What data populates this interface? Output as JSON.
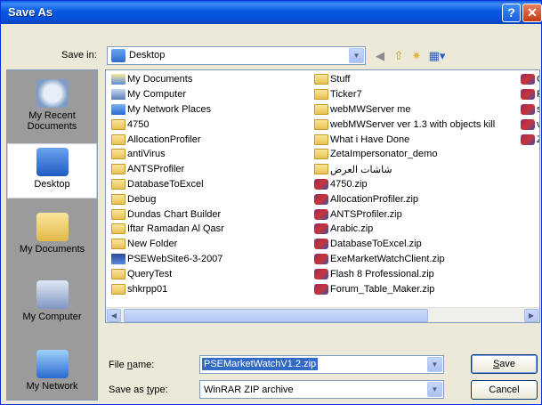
{
  "window": {
    "title": "Save As",
    "help_glyph": "?",
    "close_glyph": "✕"
  },
  "savein": {
    "label": "Save in:",
    "value": "Desktop"
  },
  "places": [
    {
      "label": "My Recent Documents",
      "icon": "recent-documents-icon"
    },
    {
      "label": "Desktop",
      "icon": "desktop-icon"
    },
    {
      "label": "My Documents",
      "icon": "my-documents-icon"
    },
    {
      "label": "My Computer",
      "icon": "my-computer-icon"
    },
    {
      "label": "My Network",
      "icon": "network-icon"
    }
  ],
  "files": {
    "col1": [
      {
        "name": "My Documents",
        "type": "docs"
      },
      {
        "name": "My Computer",
        "type": "pc"
      },
      {
        "name": "My Network Places",
        "type": "net"
      },
      {
        "name": "4750",
        "type": "folder"
      },
      {
        "name": "AllocationProfiler",
        "type": "folder"
      },
      {
        "name": "antiVirus",
        "type": "folder"
      },
      {
        "name": "ANTSProfiler",
        "type": "folder"
      },
      {
        "name": "DatabaseToExcel",
        "type": "folder"
      },
      {
        "name": "Debug",
        "type": "folder"
      },
      {
        "name": "Dundas Chart Builder",
        "type": "folder"
      },
      {
        "name": "Iftar Ramadan Al Qasr",
        "type": "folder"
      },
      {
        "name": "New Folder",
        "type": "folder"
      },
      {
        "name": "PSEWebSite6-3-2007",
        "type": "proj"
      },
      {
        "name": "QueryTest",
        "type": "folder"
      },
      {
        "name": "shkrpp01",
        "type": "folder"
      }
    ],
    "col2": [
      {
        "name": "Stuff",
        "type": "folder"
      },
      {
        "name": "Ticker7",
        "type": "folder"
      },
      {
        "name": "webMWServer me",
        "type": "folder"
      },
      {
        "name": "webMWServer ver 1.3 with objects kill",
        "type": "folder"
      },
      {
        "name": "What i Have Done",
        "type": "folder"
      },
      {
        "name": "ZetaImpersonator_demo",
        "type": "folder"
      },
      {
        "name": "شاشات العرض",
        "type": "folder"
      },
      {
        "name": "4750.zip",
        "type": "zip"
      },
      {
        "name": "AllocationProfiler.zip",
        "type": "zip"
      },
      {
        "name": "ANTSProfiler.zip",
        "type": "zip"
      },
      {
        "name": "Arabic.zip",
        "type": "zip"
      },
      {
        "name": "DatabaseToExcel.zip",
        "type": "zip"
      },
      {
        "name": "ExeMarketWatchClient.zip",
        "type": "zip"
      },
      {
        "name": "Flash 8 Professional.zip",
        "type": "zip"
      },
      {
        "name": "Forum_Table_Maker.zip",
        "type": "zip"
      }
    ],
    "col3": [
      {
        "name": "G",
        "type": "zip"
      },
      {
        "name": "P",
        "type": "zip"
      },
      {
        "name": "sl",
        "type": "zip"
      },
      {
        "name": "v",
        "type": "zip"
      },
      {
        "name": "Z",
        "type": "zip"
      }
    ]
  },
  "filename": {
    "label_prefix": "File ",
    "label_key": "n",
    "label_rest": "ame:",
    "value": "PSEMarketWatchV1.2.zip"
  },
  "savetype": {
    "label_prefix": "Save as ",
    "label_key": "t",
    "label_rest": "ype:",
    "value": "WinRAR ZIP archive"
  },
  "buttons": {
    "save_key": "S",
    "save_rest": "ave",
    "cancel": "Cancel"
  }
}
